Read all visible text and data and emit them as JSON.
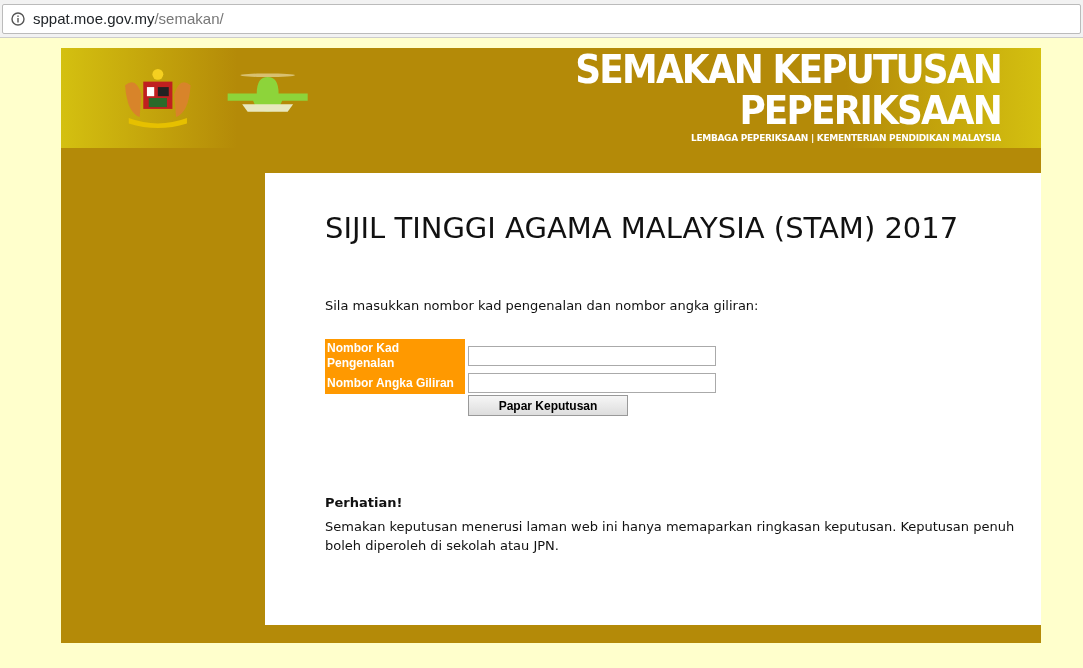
{
  "address_bar": {
    "host": "sppat.moe.gov.my",
    "path": "/semakan/"
  },
  "header": {
    "title": "SEMAKAN KEPUTUSAN PEPERIKSAAN",
    "subtitle": "LEMBAGA PEPERIKSAAN | KEMENTERIAN PENDIDIKAN MALAYSIA"
  },
  "page_title": "SIJIL TINGGI AGAMA MALAYSIA (STAM) 2017",
  "instruction": "Sila masukkan nombor kad pengenalan dan nombor angka giliran:",
  "form": {
    "fields": [
      {
        "label": "Nombor Kad Pengenalan"
      },
      {
        "label": "Nombor Angka Giliran"
      }
    ],
    "submit": "Papar Keputusan"
  },
  "notice": {
    "heading": "Perhatian!",
    "text": "Semakan keputusan menerusi laman web ini hanya memaparkan ringkasan keputusan. Keputusan penuh boleh diperoleh di sekolah atau JPN."
  }
}
